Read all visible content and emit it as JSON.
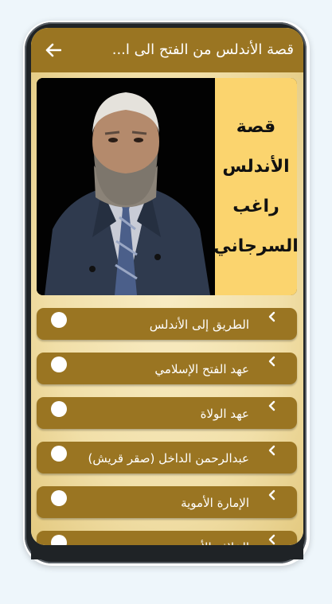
{
  "app": {
    "title": "قصة الأندلس من الفتح الى ا...",
    "accent": "#9a7522",
    "background": "#f4e6b8"
  },
  "toolbar": {
    "back_icon": "arrow-left-icon"
  },
  "banner": {
    "lines": [
      "قصة",
      "الأندلس",
      "راغب",
      "السرجاني"
    ],
    "panel_color": "#fbd46e"
  },
  "chapters": [
    {
      "label": "الطريق إلى الأندلس"
    },
    {
      "label": "عهد الفتح الإسلامي"
    },
    {
      "label": "عهد الولاة"
    },
    {
      "label": "عبدالرحمن الداخل (صقر قريش)"
    },
    {
      "label": "الإمارة الأموية"
    },
    {
      "label": "الخلافة الأموية"
    }
  ]
}
